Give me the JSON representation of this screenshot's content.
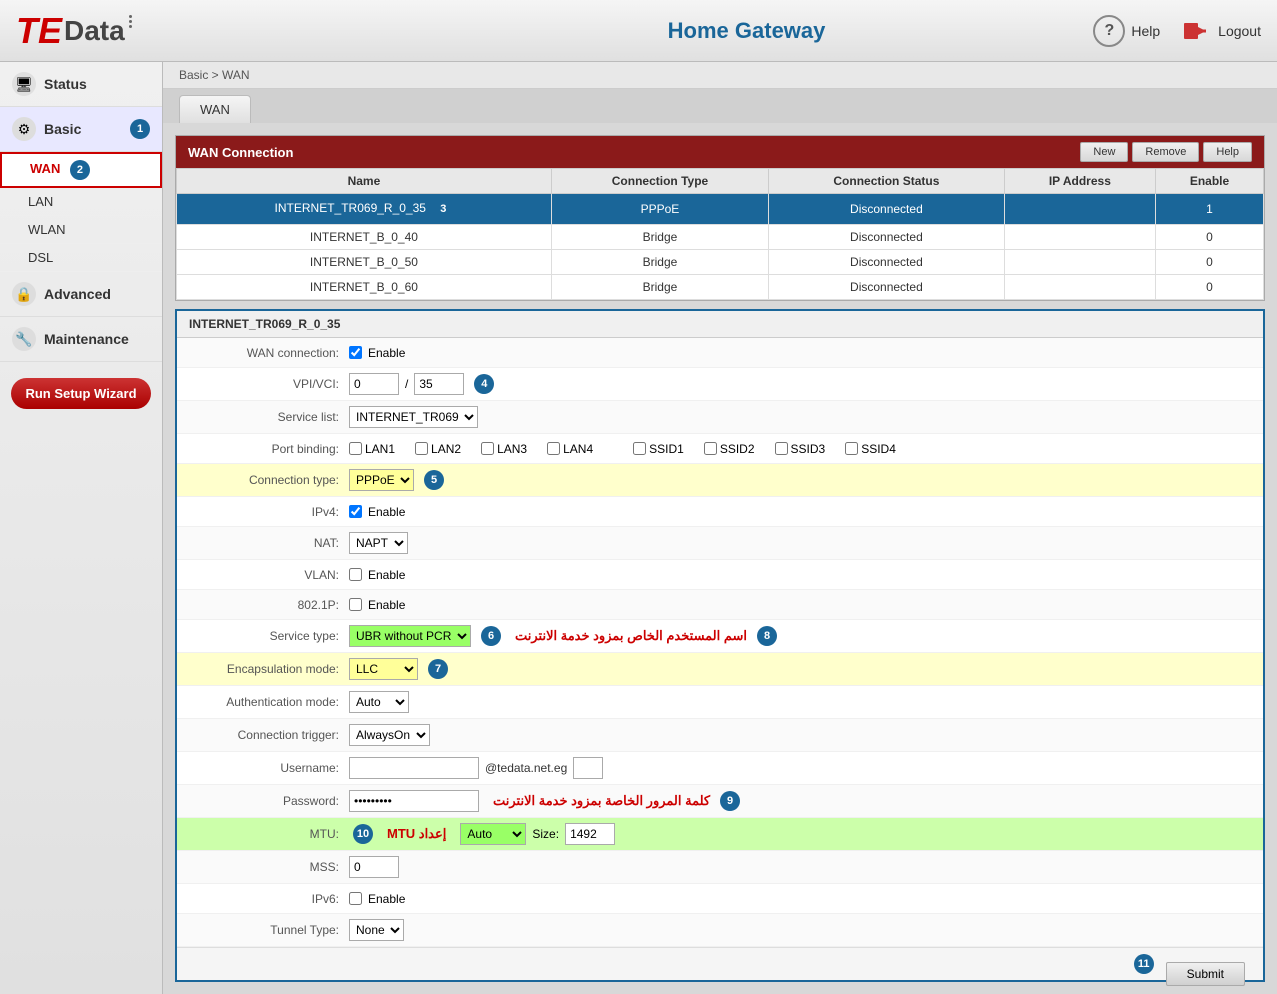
{
  "header": {
    "logo_te": "TE",
    "logo_data": "Data",
    "app_title": "Home Gateway",
    "help_label": "Help",
    "logout_label": "Logout"
  },
  "breadcrumb": "Basic > WAN",
  "tab": "WAN",
  "sidebar": {
    "items": [
      {
        "id": "status",
        "label": "Status",
        "icon": "🖥"
      },
      {
        "id": "basic",
        "label": "Basic",
        "icon": "⚙",
        "badge": "1"
      },
      {
        "id": "advanced",
        "label": "Advanced",
        "icon": "🔒"
      },
      {
        "id": "maintenance",
        "label": "Maintenance",
        "icon": "🔧"
      }
    ],
    "sub_items": [
      {
        "id": "wan",
        "label": "WAN",
        "active": true,
        "badge": "2"
      },
      {
        "id": "lan",
        "label": "LAN"
      },
      {
        "id": "wlan",
        "label": "WLAN"
      },
      {
        "id": "dsl",
        "label": "DSL"
      }
    ],
    "run_setup": "Run Setup Wizard"
  },
  "wan_table": {
    "title": "WAN Connection",
    "buttons": [
      "New",
      "Remove",
      "Help"
    ],
    "columns": [
      "Name",
      "Connection Type",
      "Connection Status",
      "IP Address",
      "Enable"
    ],
    "rows": [
      {
        "name": "INTERNET_TR069_R_0_35",
        "type": "PPPoE",
        "status": "Disconnected",
        "ip": "",
        "enable": "1",
        "selected": true
      },
      {
        "name": "INTERNET_B_0_40",
        "type": "Bridge",
        "status": "Disconnected",
        "ip": "",
        "enable": "0",
        "selected": false
      },
      {
        "name": "INTERNET_B_0_50",
        "type": "Bridge",
        "status": "Disconnected",
        "ip": "",
        "enable": "0",
        "selected": false
      },
      {
        "name": "INTERNET_B_0_60",
        "type": "Bridge",
        "status": "Disconnected",
        "ip": "",
        "enable": "0",
        "selected": false
      }
    ]
  },
  "detail": {
    "title": "INTERNET_TR069_R_0_35",
    "wan_connection_label": "WAN connection:",
    "wan_connection_value": "Enable",
    "vpi_vci_label": "VPI/VCI:",
    "vpi_value": "0",
    "vci_value": "35",
    "annot_4": "4",
    "service_list_label": "Service list:",
    "service_list_value": "INTERNET_TR069",
    "port_binding_label": "Port binding:",
    "port_binding_options": [
      "LAN1",
      "LAN2",
      "LAN3",
      "LAN4",
      "SSID1",
      "SSID2",
      "SSID3",
      "SSID4"
    ],
    "conn_type_label": "Connection type:",
    "conn_type_value": "PPPoE",
    "annot_5": "5",
    "ipv4_label": "IPv4:",
    "ipv4_value": "Enable",
    "nat_label": "NAT:",
    "nat_value": "NAPT",
    "vlan_label": "VLAN:",
    "vlan_value": "Enable",
    "dot1p_label": "802.1P:",
    "dot1p_value": "Enable",
    "service_type_label": "Service type:",
    "service_type_value": "UBR without PCR",
    "annot_6": "6",
    "arabic_8": "اسم المستخدم الخاص بمزود خدمة الانترنت",
    "encap_label": "Encapsulation mode:",
    "encap_value": "LLC",
    "annot_7": "7",
    "auth_mode_label": "Authentication mode:",
    "auth_mode_value": "Auto",
    "conn_trigger_label": "Connection trigger:",
    "conn_trigger_value": "AlwaysOn",
    "username_label": "Username:",
    "username_value": "",
    "email_suffix": "@tedata.net.eg",
    "password_label": "Password:",
    "password_value": "••••••••",
    "arabic_9": "كلمة المرور الخاصة بمزود خدمة الانترنت",
    "mtu_label": "MTU:",
    "mtu_auto": "Auto",
    "mtu_size_label": "Size:",
    "mtu_size_value": "1492",
    "annot_10": "10",
    "arabic_10": "إعداد MTU",
    "mss_label": "MSS:",
    "mss_value": "0",
    "ipv6_label": "IPv6:",
    "ipv6_value": "Enable",
    "tunnel_type_label": "Tunnel Type:",
    "tunnel_type_value": "None",
    "submit_label": "Submit",
    "annot_11": "11"
  },
  "annotations": {
    "annot_3": "3",
    "annot_8_label": "8",
    "annot_9_label": "9"
  }
}
